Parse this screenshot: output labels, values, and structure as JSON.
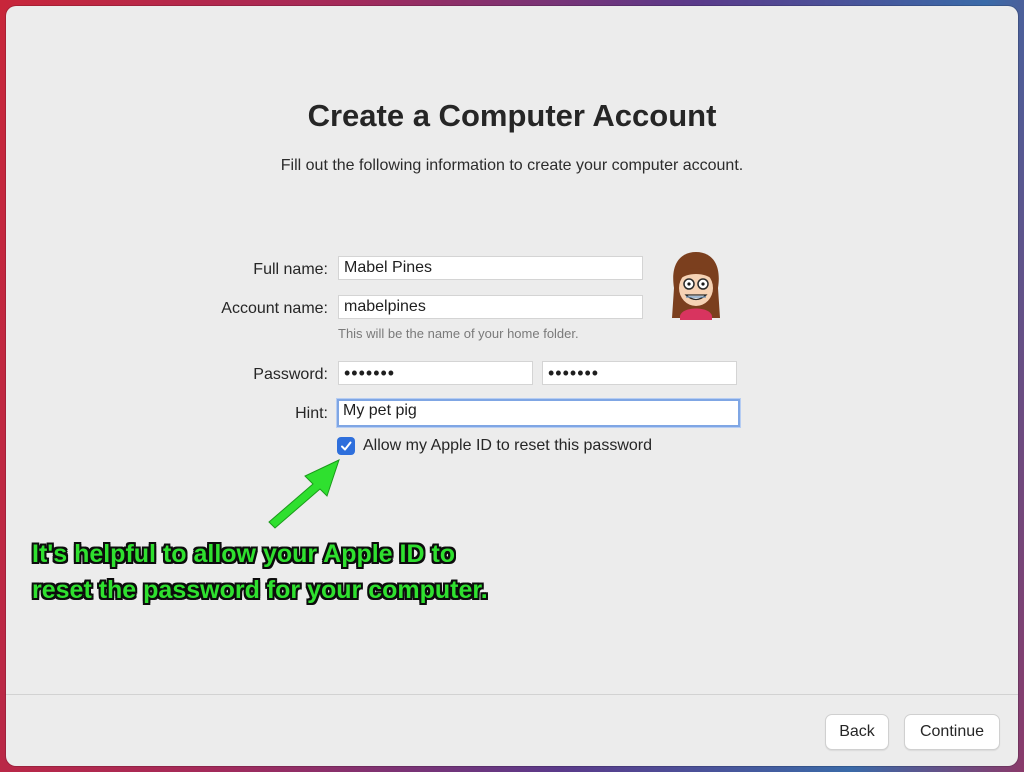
{
  "page": {
    "title": "Create a Computer Account",
    "subtitle": "Fill out the following information to create your computer account."
  },
  "form": {
    "full_name_label": "Full name:",
    "full_name_value": "Mabel Pines",
    "account_name_label": "Account name:",
    "account_name_value": "mabelpines",
    "account_name_hint": "This will be the name of your home folder.",
    "password_label": "Password:",
    "password_value": "•••••••",
    "verify_value": "•••••••",
    "hint_label": "Hint:",
    "hint_value": "My pet pig",
    "apple_id_reset_label": "Allow my Apple ID to reset this password",
    "apple_id_reset_checked": true
  },
  "annotation": {
    "callout_text": "It's helpful to allow your Apple ID to reset the password for your computer.",
    "color": "#2fe02f"
  },
  "footer": {
    "back_label": "Back",
    "continue_label": "Continue"
  },
  "colors": {
    "checkbox": "#2e6fdc",
    "window": "#ececec"
  }
}
